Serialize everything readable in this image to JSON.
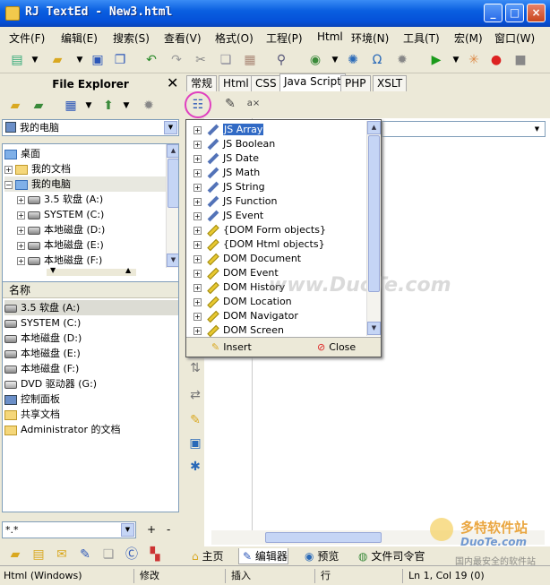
{
  "window": {
    "title": "RJ TextEd - New3.html",
    "min": "_",
    "max": "□",
    "close": "×"
  },
  "menu": [
    "文件(F)",
    "编辑(E)",
    "搜索(S)",
    "查看(V)",
    "格式(O)",
    "工程(P)",
    "Html",
    "环境(N)",
    "工具(T)",
    "宏(M)",
    "窗口(W)"
  ],
  "explorer": {
    "title": "File Explorer",
    "location": "我的电脑",
    "tree": [
      "桌面",
      "我的文档",
      "我的电脑",
      "3.5 软盘 (A:)",
      "SYSTEM (C:)",
      "本地磁盘 (D:)",
      "本地磁盘 (E:)",
      "本地磁盘 (F:)"
    ],
    "list_header": "名称",
    "list": [
      "3.5 软盘 (A:)",
      "SYSTEM (C:)",
      "本地磁盘 (D:)",
      "本地磁盘 (E:)",
      "本地磁盘 (F:)",
      "DVD 驱动器 (G:)",
      "控制面板",
      "共享文档",
      "Administrator 的文档"
    ],
    "filter": "*.*",
    "plus": "+",
    "minus": "-"
  },
  "tabs": [
    "常规",
    "Html",
    "CSS",
    "Java Script",
    "PHP",
    "XSLT"
  ],
  "active_tab": "Java Script",
  "popup": {
    "items": [
      "JS Array",
      "JS Boolean",
      "JS Date",
      "JS Math",
      "JS String",
      "JS Function",
      "JS Event",
      "{DOM Form objects}",
      "{DOM Html objects}",
      "DOM Document",
      "DOM Event",
      "DOM History",
      "DOM Location",
      "DOM Navigator",
      "DOM Screen"
    ],
    "selected": "JS Array",
    "insert": "Insert",
    "close": "Close"
  },
  "bottom_tabs": [
    "主页",
    "编辑器",
    "预览",
    "文件司令官"
  ],
  "status": {
    "mode": "Html (Windows)",
    "modified": "修改",
    "insert": "插入",
    "row": "行",
    "pos": "Ln 1, Col 19 (0)"
  },
  "watermark": {
    "site": "DuoTe.com",
    "brand": "多特软件站",
    "slogan": "国内最安全的软件站",
    "overlay": "www.DuoTe.com"
  }
}
